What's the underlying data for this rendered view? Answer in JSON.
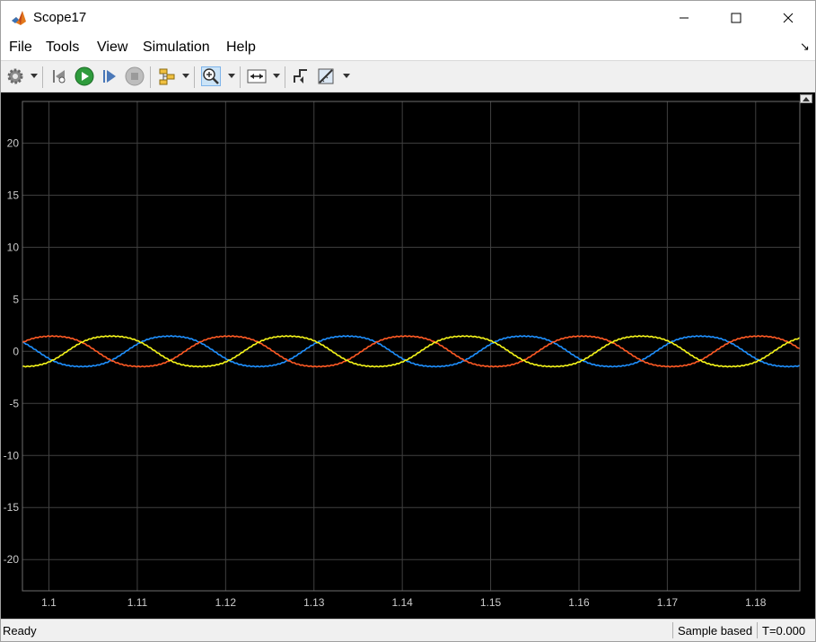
{
  "window": {
    "title": "Scope17"
  },
  "menu": {
    "file": "File",
    "tools": "Tools",
    "view": "View",
    "simulation": "Simulation",
    "help": "Help"
  },
  "toolbar": {
    "icons": [
      "gear-icon",
      "step-back-icon",
      "run-icon",
      "step-forward-icon",
      "stop-icon",
      "signal-select-icon",
      "zoom-in-icon",
      "scale-axes-icon",
      "triggers-icon",
      "measurements-icon"
    ]
  },
  "status": {
    "text": "Ready",
    "mode": "Sample based",
    "time": "T=0.000"
  },
  "colors": {
    "background": "#000000",
    "grid": "#404040",
    "tick_text": "#cccccc",
    "series1": "#1e90ff",
    "series2": "#ff5a24",
    "series3": "#f5f51a"
  },
  "chart_data": {
    "type": "line",
    "xlim": [
      1.097,
      1.185
    ],
    "ylim": [
      -23,
      24
    ],
    "xticks": [
      1.1,
      1.11,
      1.12,
      1.13,
      1.14,
      1.15,
      1.16,
      1.17,
      1.18
    ],
    "xtick_labels": [
      "1.1",
      "1.11",
      "1.12",
      "1.13",
      "1.14",
      "1.15",
      "1.16",
      "1.17",
      "1.18"
    ],
    "yticks": [
      -20,
      -15,
      -10,
      -5,
      0,
      5,
      10,
      15,
      20
    ],
    "ytick_labels": [
      "-20",
      "-15",
      "-10",
      "-5",
      "0",
      "5",
      "10",
      "15",
      "20"
    ],
    "grid": true,
    "series": [
      {
        "color": "#1e90ff",
        "amplitude": 1.55,
        "frequency_hz": 50,
        "phase_deg": 203
      },
      {
        "color": "#ff5a24",
        "amplitude": 1.55,
        "frequency_hz": 50,
        "phase_deg": 83
      },
      {
        "color": "#f5f51a",
        "amplitude": 1.55,
        "frequency_hz": 50,
        "phase_deg": 323
      }
    ]
  }
}
